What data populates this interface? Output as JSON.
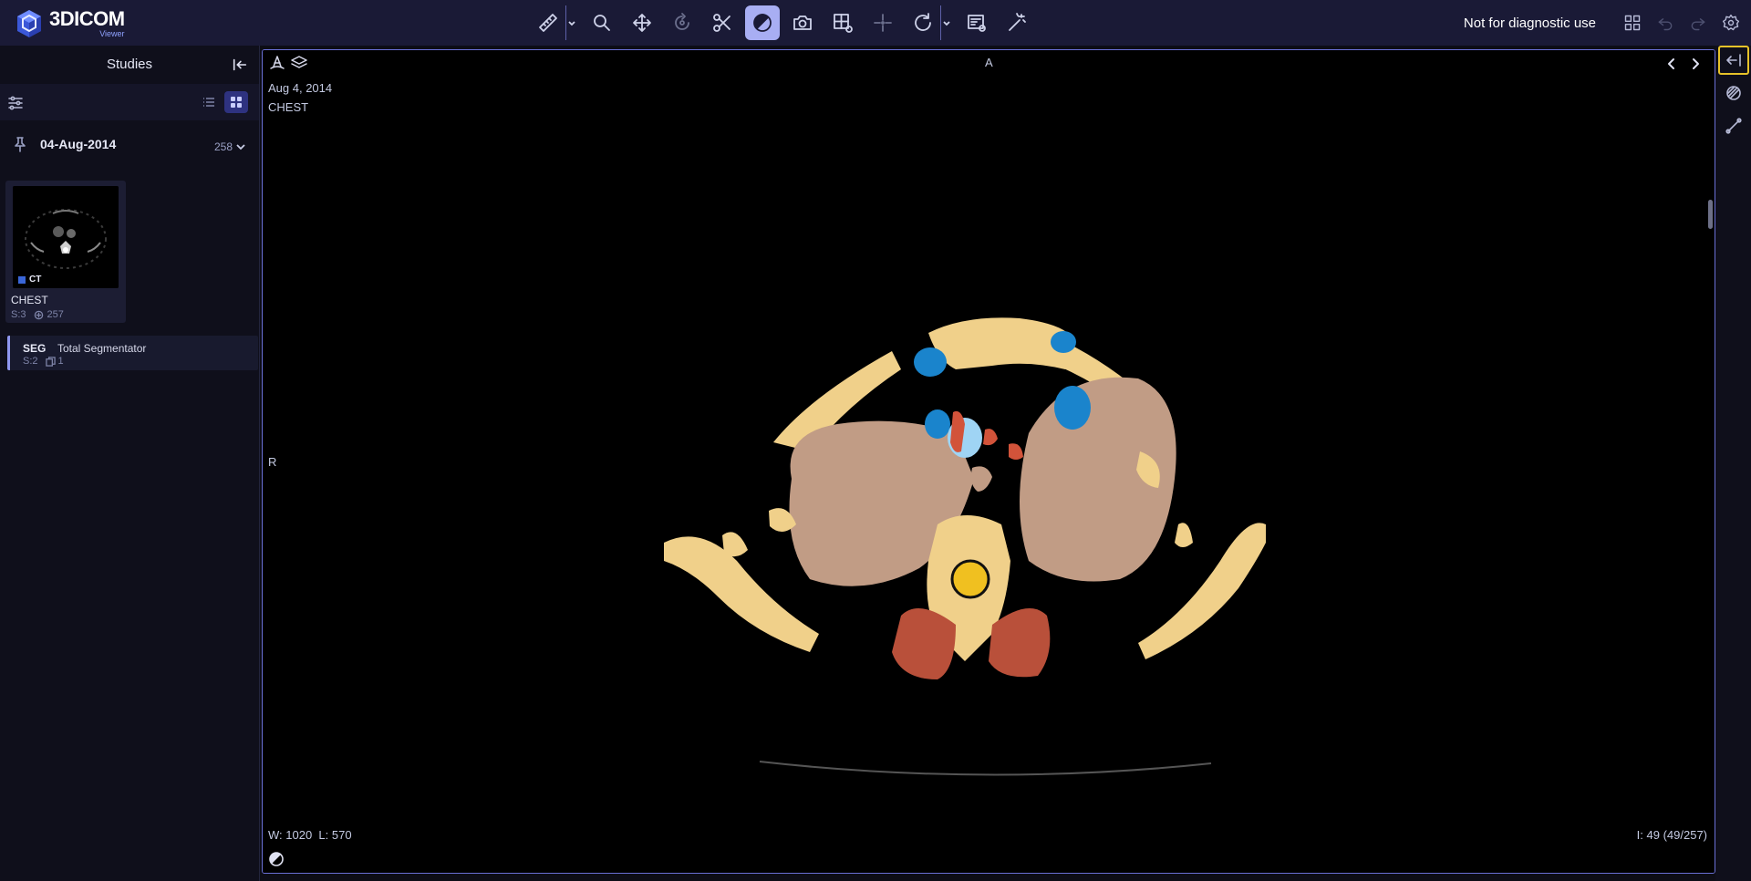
{
  "app": {
    "logo_text": "3DICOM",
    "logo_sub": "Viewer"
  },
  "toolbar": {
    "tools": [
      {
        "id": "measure",
        "icon": "ruler-icon",
        "has_menu": true,
        "state": "normal"
      },
      {
        "id": "zoom",
        "icon": "magnifier-icon",
        "state": "normal"
      },
      {
        "id": "pan",
        "icon": "move-arrows-icon",
        "state": "normal"
      },
      {
        "id": "rotate3d",
        "icon": "rotate-3d-icon",
        "state": "normal"
      },
      {
        "id": "scissors",
        "icon": "scissors-icon",
        "state": "normal"
      },
      {
        "id": "segment-brush",
        "icon": "brush-icon",
        "state": "active"
      },
      {
        "id": "capture",
        "icon": "camera-icon",
        "state": "normal"
      },
      {
        "id": "layout",
        "icon": "grid-layout-icon",
        "state": "normal"
      },
      {
        "id": "crosshair",
        "icon": "crosshair-icon",
        "state": "disabled"
      },
      {
        "id": "reset",
        "icon": "rotate-cw-icon",
        "has_menu": true,
        "state": "normal"
      },
      {
        "id": "report",
        "icon": "report-icon",
        "state": "normal"
      },
      {
        "id": "magic",
        "icon": "magic-wand-icon",
        "state": "normal"
      }
    ],
    "disclaimer": "Not for diagnostic use"
  },
  "sidebar": {
    "title": "Studies",
    "date_group": {
      "date": "04-Aug-2014",
      "count": "258"
    },
    "study": {
      "modality": "CT",
      "description": "CHEST",
      "series": "S:3",
      "images": "257"
    },
    "segmentation": {
      "tag": "SEG",
      "name": "Total Segmentator",
      "series": "S:2",
      "items": "1"
    }
  },
  "viewport": {
    "date": "Aug 4, 2014",
    "description": "CHEST",
    "orientation_top": "A",
    "orientation_left": "R",
    "window": "W: 1020",
    "level": "L: 570",
    "image_index": "I: 49 (49/257)"
  },
  "colors": {
    "bone": "#f0d08a",
    "lung": "#c19c85",
    "vessel_dark": "#1a84cc",
    "vessel_light": "#9fd4f4",
    "artery": "#d2533a",
    "muscle": "#b9503a",
    "cord": "#f0c020",
    "accent": "#a8aef3",
    "highlight": "#e6c229"
  }
}
